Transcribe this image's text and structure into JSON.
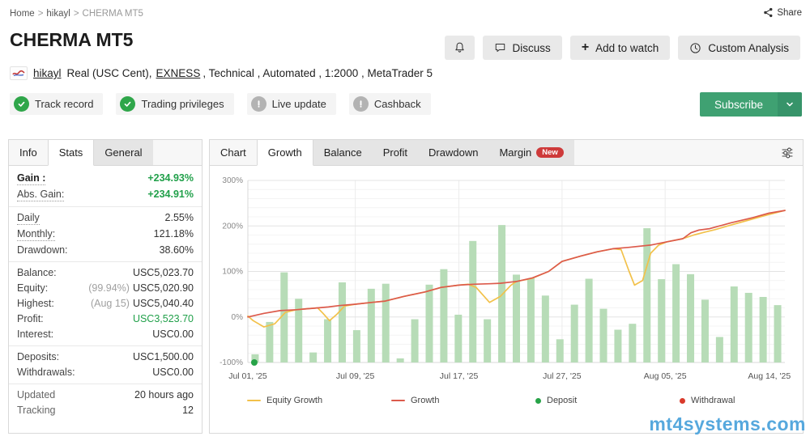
{
  "breadcrumb": {
    "home": "Home",
    "sep": ">",
    "user": "hikayl",
    "page": "CHERMA MT5"
  },
  "share": {
    "label": "Share"
  },
  "header": {
    "title": "CHERMA MT5",
    "actions": {
      "discuss": "Discuss",
      "add_to_watch": "Add to watch",
      "add_icon": "+",
      "custom_analysis": "Custom Analysis"
    },
    "account": {
      "user": "hikayl",
      "type": "Real (USC Cent),",
      "broker": "EXNESS",
      "details": ", Technical , Automated , 1:2000 , MetaTrader 5"
    },
    "badges": [
      {
        "label": "Track record",
        "status": "verified"
      },
      {
        "label": "Trading privileges",
        "status": "verified"
      },
      {
        "label": "Live update",
        "status": "unavailable"
      },
      {
        "label": "Cashback",
        "status": "unavailable"
      }
    ],
    "subscribe": {
      "label": "Subscribe"
    }
  },
  "info_panel": {
    "tabs": [
      {
        "label": "Info",
        "active": false
      },
      {
        "label": "Stats",
        "active": true
      },
      {
        "label": "General",
        "active": false
      }
    ],
    "rows": {
      "gain": {
        "label": "Gain :",
        "value": "+234.93%"
      },
      "abs_gain": {
        "label": "Abs. Gain:",
        "value": "+234.91%"
      },
      "daily": {
        "label": "Daily",
        "value": "2.55%"
      },
      "monthly": {
        "label": "Monthly:",
        "value": "121.18%"
      },
      "drawdown": {
        "label": "Drawdown:",
        "value": "38.60%"
      },
      "balance": {
        "label": "Balance:",
        "value": "USC5,023.70"
      },
      "equity": {
        "label": "Equity:",
        "pre": "(99.94%)",
        "value": "USC5,020.90"
      },
      "highest": {
        "label": "Highest:",
        "pre": "(Aug 15)",
        "value": "USC5,040.40"
      },
      "profit": {
        "label": "Profit:",
        "value": "USC3,523.70"
      },
      "interest": {
        "label": "Interest:",
        "value": "USC0.00"
      },
      "deposits": {
        "label": "Deposits:",
        "value": "USC1,500.00"
      },
      "withdrawals": {
        "label": "Withdrawals:",
        "value": "USC0.00"
      },
      "updated": {
        "label": "Updated",
        "value": "20 hours ago"
      },
      "tracking": {
        "label": "Tracking",
        "value": "12"
      }
    }
  },
  "chart_panel": {
    "tabs": [
      {
        "label": "Chart",
        "active": false
      },
      {
        "label": "Growth",
        "active": true
      },
      {
        "label": "Balance",
        "active": false
      },
      {
        "label": "Profit",
        "active": false
      },
      {
        "label": "Drawdown",
        "active": false
      },
      {
        "label": "Margin",
        "active": false,
        "badge": "New"
      }
    ]
  },
  "chart_data": {
    "type": "bar+line",
    "title": "Growth",
    "ylabel": "%",
    "ylim": [
      -100,
      300
    ],
    "yticks": [
      300,
      200,
      100,
      0,
      -100
    ],
    "grid": true,
    "legend_position": "bottom",
    "xticks": [
      {
        "label": "Jul 01, '25",
        "pos": 0.0
      },
      {
        "label": "Jul 09, '25",
        "pos": 0.2
      },
      {
        "label": "Jul 17, '25",
        "pos": 0.393
      },
      {
        "label": "Jul 27, '25",
        "pos": 0.585
      },
      {
        "label": "Aug 05, '25",
        "pos": 0.777
      },
      {
        "label": "Aug 14, '25",
        "pos": 0.971
      }
    ],
    "bars": {
      "name": "Daily growth",
      "color": "#b7dcb7",
      "baseline": -100,
      "values": [
        -82,
        -11,
        98,
        40,
        -78,
        -5,
        76,
        -29,
        62,
        73,
        -91,
        -5,
        71,
        105,
        5,
        167,
        -5,
        202,
        93,
        85,
        47,
        -49,
        27,
        84,
        18,
        -28,
        -15,
        195,
        83,
        116,
        94,
        38,
        -44,
        67,
        53,
        44,
        26
      ]
    },
    "series": [
      {
        "name": "Equity Growth",
        "color": "#f2c14a",
        "points": [
          [
            0,
            2
          ],
          [
            0.01,
            -8
          ],
          [
            0.03,
            -22
          ],
          [
            0.05,
            -15
          ],
          [
            0.07,
            10
          ],
          [
            0.09,
            16
          ],
          [
            0.11,
            18
          ],
          [
            0.13,
            20
          ],
          [
            0.14,
            8
          ],
          [
            0.152,
            -8
          ],
          [
            0.165,
            5
          ],
          [
            0.18,
            24
          ],
          [
            0.2,
            28
          ],
          [
            0.23,
            32
          ],
          [
            0.256,
            35
          ],
          [
            0.29,
            45
          ],
          [
            0.33,
            55
          ],
          [
            0.36,
            65
          ],
          [
            0.393,
            70
          ],
          [
            0.41,
            72
          ],
          [
            0.425,
            65
          ],
          [
            0.45,
            32
          ],
          [
            0.47,
            45
          ],
          [
            0.49,
            70
          ],
          [
            0.5,
            78
          ],
          [
            0.53,
            85
          ],
          [
            0.56,
            100
          ],
          [
            0.585,
            122
          ],
          [
            0.62,
            134
          ],
          [
            0.65,
            143
          ],
          [
            0.68,
            150
          ],
          [
            0.695,
            148
          ],
          [
            0.71,
            100
          ],
          [
            0.72,
            70
          ],
          [
            0.735,
            80
          ],
          [
            0.75,
            140
          ],
          [
            0.765,
            158
          ],
          [
            0.78,
            165
          ],
          [
            0.81,
            172
          ],
          [
            0.83,
            180
          ],
          [
            0.85,
            186
          ],
          [
            0.87,
            192
          ],
          [
            0.9,
            202
          ],
          [
            0.93,
            212
          ],
          [
            0.96,
            222
          ],
          [
            1,
            234
          ]
        ]
      },
      {
        "name": "Growth",
        "color": "#dc5a4b",
        "points": [
          [
            0,
            0
          ],
          [
            0.03,
            8
          ],
          [
            0.06,
            14
          ],
          [
            0.09,
            16
          ],
          [
            0.12,
            19
          ],
          [
            0.15,
            22
          ],
          [
            0.17,
            25
          ],
          [
            0.2,
            28
          ],
          [
            0.23,
            32
          ],
          [
            0.256,
            35
          ],
          [
            0.29,
            45
          ],
          [
            0.33,
            55
          ],
          [
            0.36,
            65
          ],
          [
            0.393,
            70
          ],
          [
            0.42,
            72
          ],
          [
            0.45,
            73
          ],
          [
            0.47,
            74
          ],
          [
            0.5,
            78
          ],
          [
            0.53,
            86
          ],
          [
            0.56,
            100
          ],
          [
            0.585,
            122
          ],
          [
            0.62,
            134
          ],
          [
            0.65,
            143
          ],
          [
            0.68,
            150
          ],
          [
            0.71,
            153
          ],
          [
            0.75,
            158
          ],
          [
            0.78,
            165
          ],
          [
            0.81,
            172
          ],
          [
            0.825,
            185
          ],
          [
            0.84,
            191
          ],
          [
            0.86,
            194
          ],
          [
            0.9,
            207
          ],
          [
            0.94,
            218
          ],
          [
            0.97,
            228
          ],
          [
            1,
            234
          ]
        ]
      }
    ],
    "markers": [
      {
        "type": "deposit",
        "color": "#27a348",
        "x": 0.012,
        "y": -100
      }
    ],
    "legend": [
      {
        "label": "Equity Growth",
        "type": "line",
        "color": "#f2c14a"
      },
      {
        "label": "Growth",
        "type": "line",
        "color": "#dc5a4b"
      },
      {
        "label": "Deposit",
        "type": "dot",
        "color": "#27a348"
      },
      {
        "label": "Withdrawal",
        "type": "dot",
        "color": "#d93a2b"
      }
    ]
  },
  "watermark": "mt4systems.com",
  "colors": {
    "accent_green": "#3fa172",
    "positive": "#21a04a",
    "badge_new": "#ce3a3a",
    "bar": "#b7dcb7",
    "equity_line": "#f2c14a",
    "growth_line": "#dc5a4b",
    "deposit": "#27a348",
    "withdrawal": "#d93a2b"
  }
}
